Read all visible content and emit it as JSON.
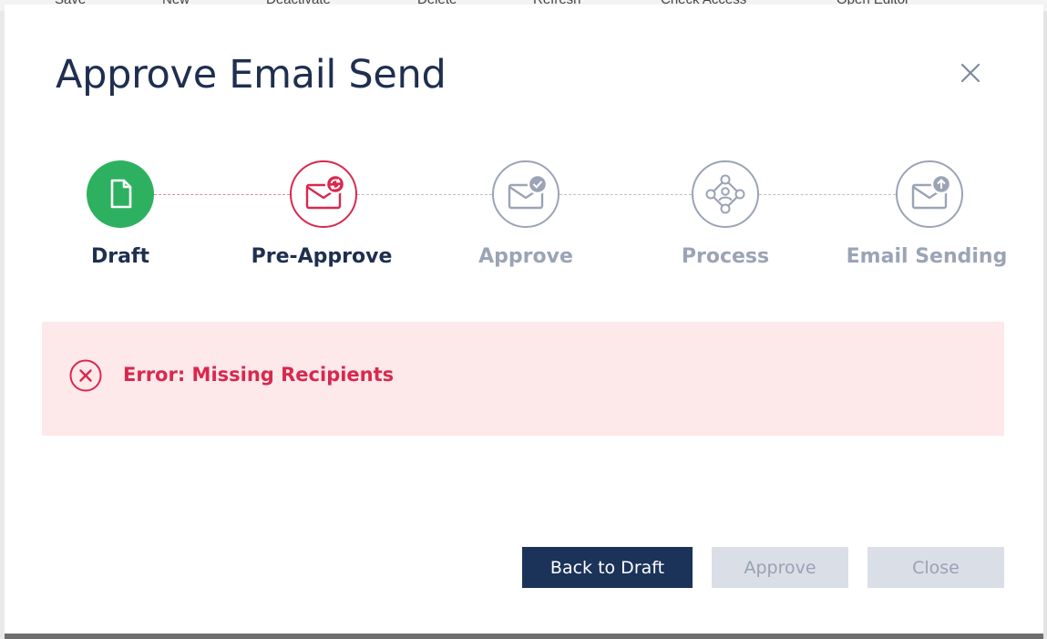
{
  "background_toolbar": {
    "items": [
      "Save",
      "New",
      "Deactivate",
      "Delete",
      "Refresh",
      "Check Access",
      "Open Editor"
    ]
  },
  "dialog": {
    "title": "Approve Email Send",
    "close_icon": "close-icon"
  },
  "stepper": {
    "steps": [
      {
        "label": "Draft",
        "status": "completed",
        "icon": "document-icon"
      },
      {
        "label": "Pre-Approve",
        "status": "error",
        "icon": "envelope-refresh-icon"
      },
      {
        "label": "Approve",
        "status": "pending",
        "icon": "envelope-check-icon"
      },
      {
        "label": "Process",
        "status": "pending",
        "icon": "process-user-icon"
      },
      {
        "label": "Email Sending",
        "status": "pending",
        "icon": "envelope-upload-icon"
      }
    ]
  },
  "error": {
    "icon": "error-circle-icon",
    "message": "Error: Missing Recipients"
  },
  "buttons": {
    "back_to_draft": "Back to Draft",
    "approve": "Approve",
    "close": "Close"
  },
  "colors": {
    "completed": "#2db161",
    "error": "#d8284e",
    "pending": "#9ba4b5",
    "title": "#1e2f4f",
    "primary_button": "#1b3359",
    "disabled_button": "#dadfe7",
    "error_background": "#fde8ea"
  }
}
